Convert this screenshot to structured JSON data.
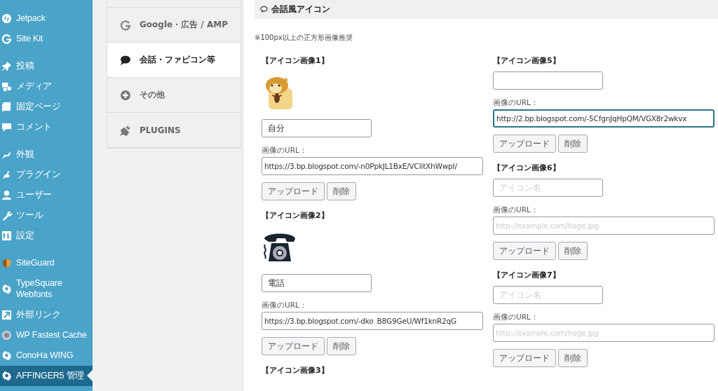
{
  "sidebar": {
    "groups": [
      [
        {
          "label": "Jetpack",
          "selected": false
        },
        {
          "label": "Site Kit",
          "selected": false
        }
      ],
      [
        {
          "label": "投稿",
          "selected": false
        },
        {
          "label": "メディア",
          "selected": false
        },
        {
          "label": "固定ページ",
          "selected": false
        },
        {
          "label": "コメント",
          "selected": false
        }
      ],
      [
        {
          "label": "外観",
          "selected": false
        },
        {
          "label": "プラグイン",
          "selected": false
        },
        {
          "label": "ユーザー",
          "selected": false
        },
        {
          "label": "ツール",
          "selected": false
        },
        {
          "label": "設定",
          "selected": false
        }
      ],
      [
        {
          "label": "SiteGuard",
          "selected": false
        },
        {
          "label": "TypeSquare Webfonts",
          "selected": false
        },
        {
          "label": "外部リンク",
          "selected": false
        },
        {
          "label": "WP Fastest Cache",
          "selected": false
        },
        {
          "label": "ConoHa WING",
          "selected": false
        },
        {
          "label": "AFFINGER5 管理",
          "selected": true
        }
      ]
    ]
  },
  "tabs": [
    {
      "label": "Google・広告 / AMP",
      "selected": false
    },
    {
      "label": "会話・ファビコン等",
      "selected": true
    },
    {
      "label": "その他",
      "selected": false
    },
    {
      "label": "PLUGINS",
      "selected": false
    }
  ],
  "section": {
    "title": "会話風アイコン",
    "note": "※100px以上の正方形画像推奨",
    "columns": [
      [
        {
          "title": "【アイコン画像1】",
          "kind": "picture",
          "name": {
            "value": "自分"
          },
          "url_label": "画像のURL：",
          "url": {
            "value": "https://3.bp.blogspot.com/-n0PpkJL1BxE/VClitXhWwpI/",
            "focused": false
          },
          "buttons": [
            "アップロード",
            "削除"
          ]
        },
        {
          "title": "【アイコン画像2】",
          "kind": "picture",
          "name": {
            "value": "電話"
          },
          "url_label": "画像のURL：",
          "url": {
            "value": "https://3.bp.blogspot.com/-dko_B8G9GeU/Wf1knR2qG",
            "focused": false
          },
          "buttons": [
            "アップロード",
            "削除"
          ]
        },
        {
          "title": "【アイコン画像3】",
          "kind": "title_only"
        }
      ],
      [
        {
          "title": "【アイコン画像5】",
          "kind": "plain",
          "url_label": "画像のURL：",
          "url": {
            "value": "http://2.bp.blogspot.com/-5CfgnJqHpQM/VGX8r2wkvx",
            "focused": true
          },
          "buttons": [
            "アップロード",
            "削除"
          ]
        },
        {
          "title": "【アイコン画像6】",
          "kind": "plain",
          "name": {
            "placeholder": "アイコン名"
          },
          "url_label": "画像のURL：",
          "url": {
            "placeholder": "http://example.com/hoge.jpg",
            "focused": false
          },
          "buttons": [
            "アップロード",
            "削除"
          ]
        },
        {
          "title": "【アイコン画像7】",
          "kind": "plain",
          "name": {
            "placeholder": "アイコン名"
          },
          "url_label": "画像のURL：",
          "url": {
            "placeholder": "http://example.com/hoge.jpg",
            "focused": false
          },
          "buttons": [
            "アップロード",
            "削除"
          ]
        }
      ]
    ]
  }
}
